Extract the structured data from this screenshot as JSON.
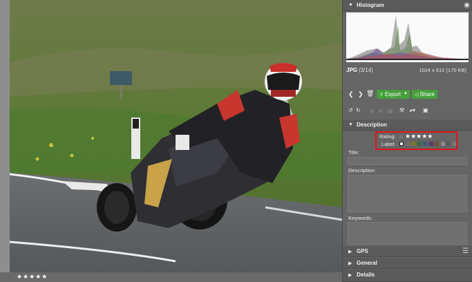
{
  "viewer": {
    "bottom_rating": "★★★★★"
  },
  "panel": {
    "histogram": {
      "title": "Histogram",
      "collapse_icon": "triangle-down-icon"
    },
    "file": {
      "type": "JPG",
      "index": "(3/14)",
      "dims": "1024 x 612 (170 KB)"
    },
    "toolbar": {
      "export_label": "Export",
      "share_label": "Share"
    },
    "description": {
      "title": "Description",
      "rating_label": "Rating:",
      "rating_stars": "★★★★★",
      "label_label": "Label:",
      "label_colors": [
        "#ffffff",
        "#6c6c6c",
        "#7a7a2a",
        "#3a6a3a",
        "#3a5a80",
        "#5a3a6a",
        "#7a5030",
        "#8a8a8a",
        "#5a5a5a",
        "#7c7c7c"
      ],
      "title_field_label": "Title:",
      "description_field_label": "Description:",
      "keywords_field_label": "Keywords:"
    },
    "sections": {
      "gps": "GPS",
      "general": "General",
      "details": "Details"
    }
  },
  "colors": {
    "accent_green": "#45a03c",
    "highlight_red": "#e1141a"
  }
}
